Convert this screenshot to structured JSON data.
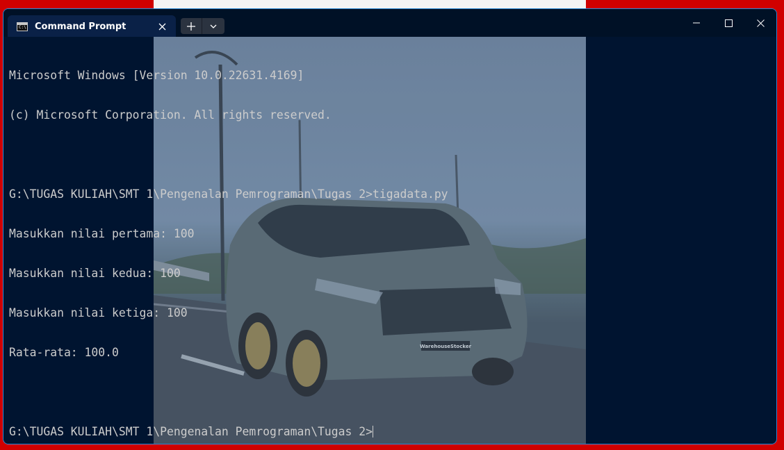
{
  "window": {
    "tab": {
      "title": "Command Prompt",
      "icon": "cmd-icon",
      "icon_text": "C:\\"
    },
    "controls": {
      "close_tab": "close-icon",
      "new_tab": "plus-icon",
      "dropdown": "chevron-down-icon",
      "minimize": "minimize-icon",
      "maximize": "maximize-icon",
      "close": "close-icon"
    }
  },
  "terminal": {
    "lines": [
      "Microsoft Windows [Version 10.0.22631.4169]",
      "(c) Microsoft Corporation. All rights reserved.",
      "",
      "G:\\TUGAS KULIAH\\SMT 1\\Pengenalan Pemrograman\\Tugas 2>tigadata.py",
      "Masukkan nilai pertama: 100",
      "Masukkan nilai kedua: 100",
      "Masukkan nilai ketiga: 100",
      "Rata-rata: 100.0",
      "",
      "G:\\TUGAS KULIAH\\SMT 1\\Pengenalan Pemrograman\\Tugas 2>"
    ]
  },
  "background": {
    "image": "car-on-road-photo",
    "plate_text": "WarehouseStocker"
  },
  "colors": {
    "terminal_bg": "#001430",
    "terminal_text": "#cccccc",
    "tab_bg": "#0a2147",
    "accent_border": "#2c8ad6",
    "desktop_bg": "#d00000"
  }
}
